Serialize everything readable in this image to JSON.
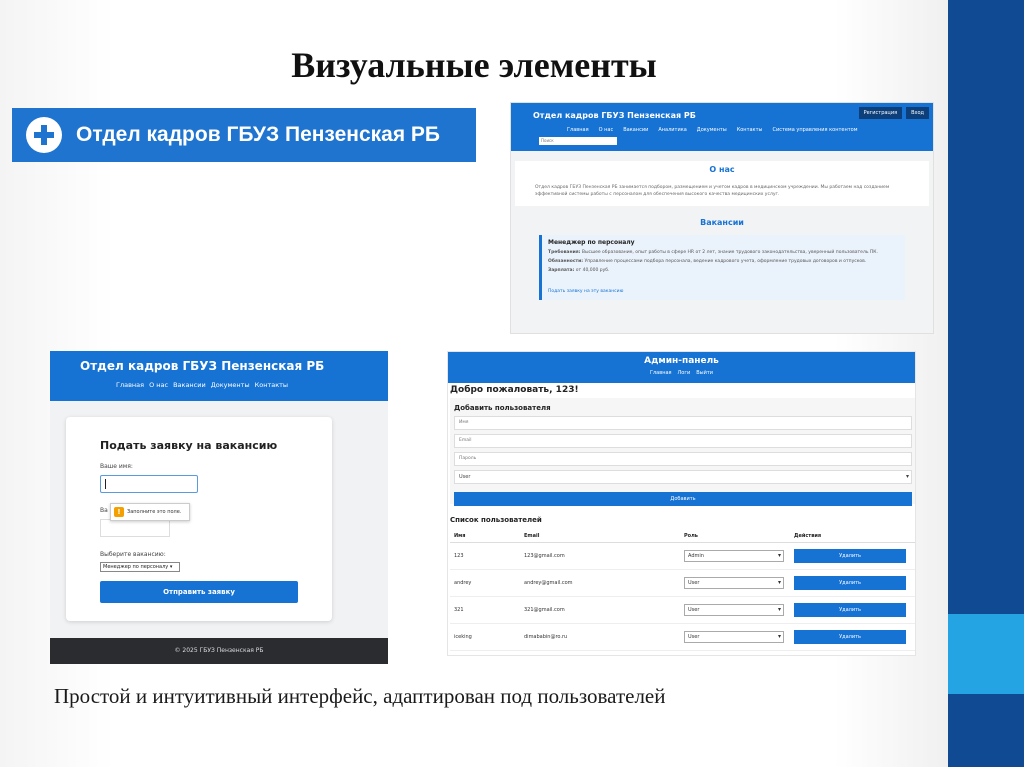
{
  "slide": {
    "title": "Визуальные элементы",
    "caption": "Простой и интуитивный интерфейс, адаптирован под пользователей"
  },
  "logo": {
    "text": "Отдел кадров ГБУЗ Пензенская РБ",
    "icon": "plus-circle-icon"
  },
  "site": {
    "title": "Отдел кадров ГБУЗ Пензенская РБ",
    "buttons": {
      "register": "Регистрация",
      "login": "Вход"
    },
    "nav": [
      "Главная",
      "О нас",
      "Вакансии",
      "Аналитика",
      "Документы",
      "Контакты",
      "Система управления контентом"
    ],
    "search_placeholder": "Поиск",
    "about": {
      "heading": "О нас",
      "text": "Отдел кадров ГБУЗ Пензенская РБ занимается подбором, размещением и учетом кадров в медицинском учреждении. Мы работаем над созданием эффективной системы работы с персоналом для обеспечения высокого качества медицинских услуг."
    },
    "vacancies": {
      "heading": "Вакансии",
      "card": {
        "title": "Менеджер по персоналу",
        "requirements_label": "Требования:",
        "requirements": "Высшее образование, опыт работы в сфере HR от 2 лет, знание трудового законодательства, уверенный пользователь ПК.",
        "duties_label": "Обязанности:",
        "duties": "Управление процессами подбора персонала, ведение кадрового учета, оформление трудовых договоров и отпусков.",
        "salary_label": "Зарплата:",
        "salary": "от 40,000 руб.",
        "link": "Подать заявку на эту вакансию"
      }
    }
  },
  "form": {
    "site_title": "Отдел кадров ГБУЗ Пензенская РБ",
    "nav": [
      "Главная",
      "О нас",
      "Вакансии",
      "Документы",
      "Контакты"
    ],
    "heading": "Подать заявку на вакансию",
    "name_label": "Ваше имя:",
    "second_label": "Ва",
    "tooltip": "Заполните это поле.",
    "vacancy_label": "Выберите вакансию:",
    "vacancy_value": "Менеджер по персоналу",
    "submit": "Отправить заявку",
    "footer": "© 2025 ГБУЗ Пензенская РБ"
  },
  "admin": {
    "title": "Админ-панель",
    "nav": [
      "Главная",
      "Логи",
      "Выйти"
    ],
    "welcome": "Добро пожаловать, 123!",
    "add_heading": "Добавить пользователя",
    "placeholders": {
      "name": "Имя",
      "email": "Email",
      "password": "Пароль"
    },
    "role_default": "User",
    "add_button": "Добавить",
    "list_heading": "Список пользователей",
    "columns": [
      "Имя",
      "Email",
      "Роль",
      "Действия"
    ],
    "delete_label": "Удалить",
    "users": [
      {
        "name": "123",
        "email": "123@gmail.com",
        "role": "Admin"
      },
      {
        "name": "andrey",
        "email": "andrey@gmail.com",
        "role": "User"
      },
      {
        "name": "321",
        "email": "321@gmail.com",
        "role": "User"
      },
      {
        "name": "iceking",
        "email": "dimababin@ro.ru",
        "role": "User"
      }
    ]
  },
  "colors": {
    "primary": "#1673d4",
    "dark_blue": "#0f4a93",
    "accent": "#25a4e3",
    "footer": "#2a2c30"
  }
}
